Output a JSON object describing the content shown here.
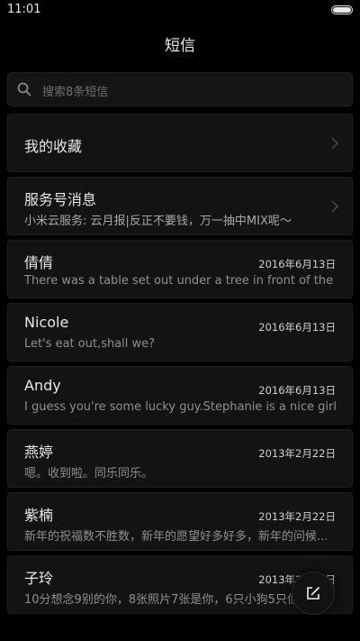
{
  "status_bar": {
    "time": "11:01",
    "battery_level": 1.0
  },
  "header": {
    "title": "短信"
  },
  "search": {
    "placeholder": "搜索8条短信",
    "icon": "search-icon"
  },
  "favorites": {
    "label": "我的收藏",
    "icon": "chevron-right-icon"
  },
  "service": {
    "label": "服务号消息",
    "preview": "小米云服务: 云月报|反正不要钱，万一抽中MIX呢～",
    "icon": "chevron-right-icon"
  },
  "conversations": [
    {
      "name": "倩倩",
      "date": "2016年6月13日",
      "preview": "There was a table set out under a tree in front of the ho.."
    },
    {
      "name": "Nicole",
      "date": "2016年6月13日",
      "preview": "Let's eat out,shall we?"
    },
    {
      "name": "Andy",
      "date": "2016年6月13日",
      "preview": "I guess you're some lucky guy.Stephanie is a nice girl."
    },
    {
      "name": "燕婷",
      "date": "2013年2月22日",
      "preview": "嗯。收到啦。同乐同乐。"
    },
    {
      "name": "紫楠",
      "date": "2013年2月22日",
      "preview": "新年的祝福数不胜数，新年的愿望好多好多，新年的问候..."
    },
    {
      "name": "子玲",
      "date": "2013年2月22日",
      "preview": "10分想念9别的你，8张照片7张是你，6只小狗5只像你..."
    }
  ],
  "compose": {
    "icon": "compose-icon"
  },
  "colors": {
    "background": "#000000",
    "card": "#131313",
    "secondary_text": "#8f8f8f"
  }
}
